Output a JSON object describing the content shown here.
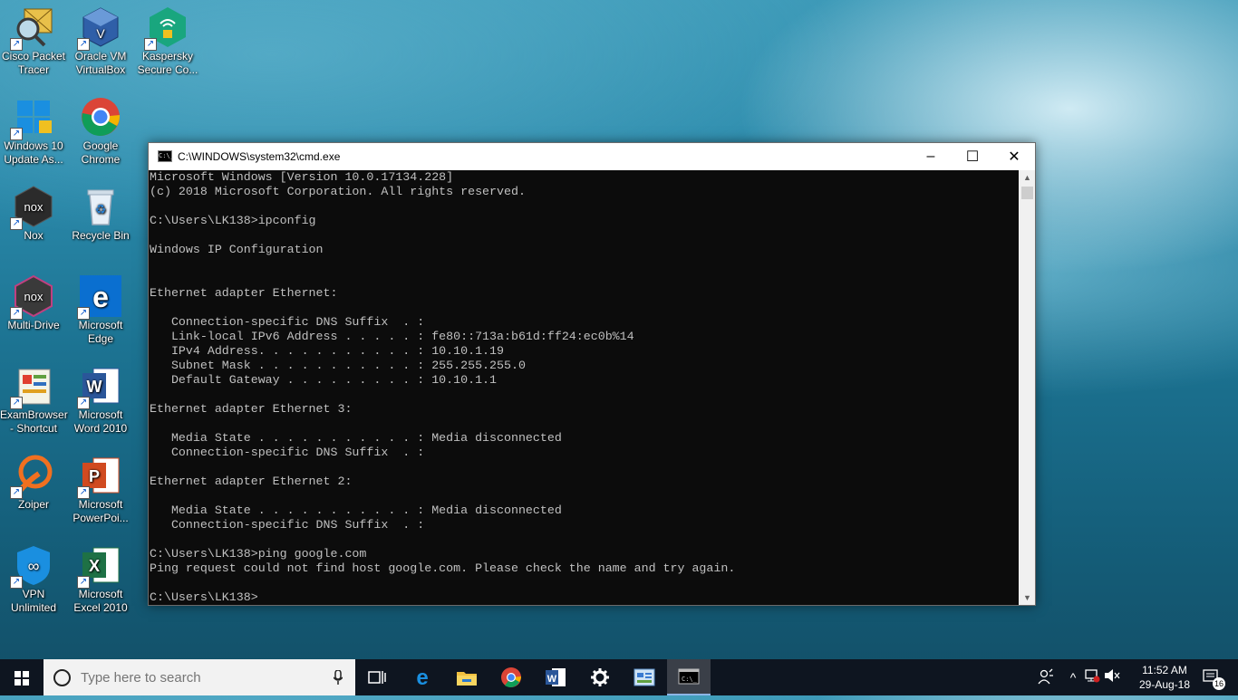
{
  "desktop": {
    "icons": [
      {
        "label1": "Cisco Packet",
        "label2": "Tracer"
      },
      {
        "label1": "Oracle VM",
        "label2": "VirtualBox"
      },
      {
        "label1": "Kaspersky",
        "label2": "Secure Co..."
      },
      {
        "label1": "Windows 10",
        "label2": "Update As..."
      },
      {
        "label1": "Google",
        "label2": "Chrome"
      },
      {
        "label1": "Nox",
        "label2": ""
      },
      {
        "label1": "Recycle Bin",
        "label2": ""
      },
      {
        "label1": "Multi-Drive",
        "label2": ""
      },
      {
        "label1": "Microsoft",
        "label2": "Edge"
      },
      {
        "label1": "ExamBrowser",
        "label2": "- Shortcut"
      },
      {
        "label1": "Microsoft",
        "label2": "Word 2010"
      },
      {
        "label1": "Zoiper",
        "label2": ""
      },
      {
        "label1": "Microsoft",
        "label2": "PowerPoi..."
      },
      {
        "label1": "VPN",
        "label2": "Unlimited"
      },
      {
        "label1": "Microsoft",
        "label2": "Excel 2010"
      }
    ]
  },
  "window": {
    "title": "C:\\WINDOWS\\system32\\cmd.exe",
    "icon_text": "C:\\_",
    "minimize": "–",
    "maximize": "☐",
    "close": "✕",
    "console_lines": [
      "Microsoft Windows [Version 10.0.17134.228]",
      "(c) 2018 Microsoft Corporation. All rights reserved.",
      "",
      "C:\\Users\\LK138>ipconfig",
      "",
      "Windows IP Configuration",
      "",
      "",
      "Ethernet adapter Ethernet:",
      "",
      "   Connection-specific DNS Suffix  . :",
      "   Link-local IPv6 Address . . . . . : fe80::713a:b61d:ff24:ec0b%14",
      "   IPv4 Address. . . . . . . . . . . : 10.10.1.19",
      "   Subnet Mask . . . . . . . . . . . : 255.255.255.0",
      "   Default Gateway . . . . . . . . . : 10.10.1.1",
      "",
      "Ethernet adapter Ethernet 3:",
      "",
      "   Media State . . . . . . . . . . . : Media disconnected",
      "   Connection-specific DNS Suffix  . :",
      "",
      "Ethernet adapter Ethernet 2:",
      "",
      "   Media State . . . . . . . . . . . : Media disconnected",
      "   Connection-specific DNS Suffix  . :",
      "",
      "C:\\Users\\LK138>ping google.com",
      "Ping request could not find host google.com. Please check the name and try again.",
      "",
      "C:\\Users\\LK138>"
    ]
  },
  "taskbar": {
    "search_placeholder": "Type here to search",
    "apps": [
      "task-view",
      "edge",
      "file-explorer",
      "chrome",
      "word",
      "settings",
      "control-panel",
      "cmd"
    ],
    "clock_time": "11:52 AM",
    "clock_date": "29-Aug-18",
    "notification_count": "16"
  }
}
